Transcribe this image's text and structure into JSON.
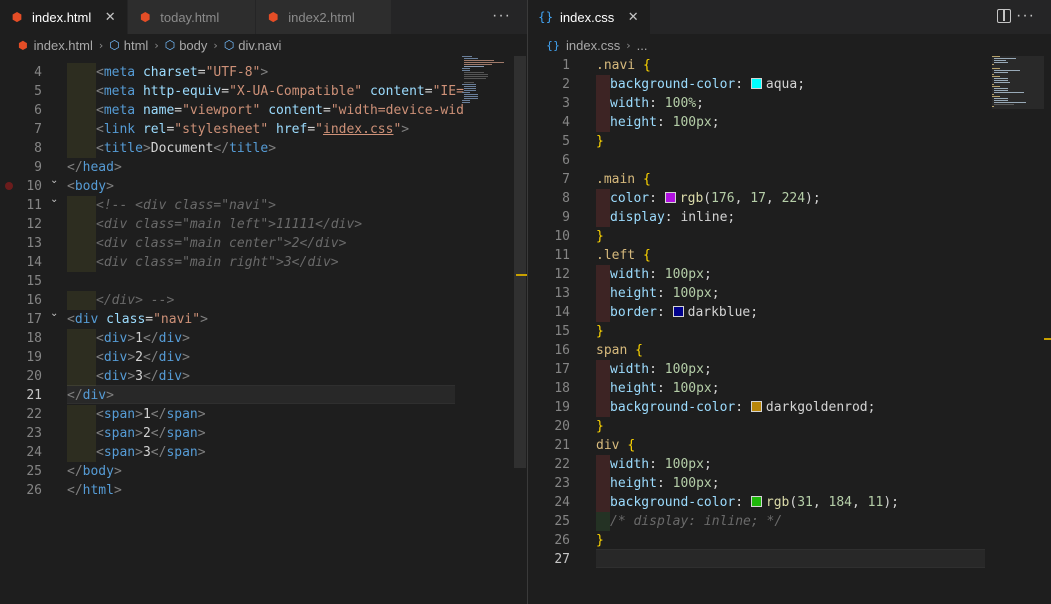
{
  "left_editor": {
    "tabs": [
      {
        "label": "index.html",
        "icon": "html5-icon",
        "active": true
      },
      {
        "label": "today.html",
        "icon": "html5-icon",
        "active": false
      },
      {
        "label": "index2.html",
        "icon": "html5-icon",
        "active": false
      }
    ],
    "more_actions": "···",
    "breadcrumb": [
      "index.html",
      "html",
      "body",
      "div.navi"
    ],
    "current_line": 21,
    "lines": [
      {
        "n": 4,
        "tokens": [
          [
            "g",
            ""
          ],
          [
            "tg",
            "<"
          ],
          [
            "tag",
            "meta "
          ],
          [
            "attr",
            "charset"
          ],
          [
            "pun",
            "="
          ],
          [
            "str",
            "\"UTF-8\""
          ],
          [
            "tg",
            ">"
          ]
        ]
      },
      {
        "n": 5,
        "tokens": [
          [
            "g",
            ""
          ],
          [
            "tg",
            "<"
          ],
          [
            "tag",
            "meta "
          ],
          [
            "attr",
            "http-equiv"
          ],
          [
            "pun",
            "="
          ],
          [
            "str",
            "\"X-UA-Compatible\""
          ],
          [
            "txt",
            " "
          ],
          [
            "attr",
            "content"
          ],
          [
            "pun",
            "="
          ],
          [
            "str",
            "\"IE="
          ]
        ]
      },
      {
        "n": 6,
        "tokens": [
          [
            "g",
            ""
          ],
          [
            "tg",
            "<"
          ],
          [
            "tag",
            "meta "
          ],
          [
            "attr",
            "name"
          ],
          [
            "pun",
            "="
          ],
          [
            "str",
            "\"viewport\""
          ],
          [
            "txt",
            " "
          ],
          [
            "attr",
            "content"
          ],
          [
            "pun",
            "="
          ],
          [
            "str",
            "\"width=device-wid"
          ]
        ]
      },
      {
        "n": 7,
        "tokens": [
          [
            "g",
            ""
          ],
          [
            "tg",
            "<"
          ],
          [
            "tag",
            "link "
          ],
          [
            "attr",
            "rel"
          ],
          [
            "pun",
            "="
          ],
          [
            "str",
            "\"stylesheet\""
          ],
          [
            "txt",
            " "
          ],
          [
            "attr",
            "href"
          ],
          [
            "pun",
            "="
          ],
          [
            "str",
            "\""
          ],
          [
            "stru",
            "index.css"
          ],
          [
            "str",
            "\""
          ],
          [
            "tg",
            ">"
          ]
        ]
      },
      {
        "n": 8,
        "tokens": [
          [
            "g",
            ""
          ],
          [
            "tg",
            "<"
          ],
          [
            "tag",
            "title"
          ],
          [
            "tg",
            ">"
          ],
          [
            "txt",
            "Document"
          ],
          [
            "tg",
            "</"
          ],
          [
            "tag",
            "title"
          ],
          [
            "tg",
            ">"
          ]
        ]
      },
      {
        "n": 9,
        "tokens": [
          [
            "tg",
            "</"
          ],
          [
            "tag",
            "head"
          ],
          [
            "tg",
            ">"
          ]
        ]
      },
      {
        "n": 10,
        "tokens": [
          [
            "tg",
            "<"
          ],
          [
            "tag",
            "body"
          ],
          [
            "tg",
            ">"
          ]
        ]
      },
      {
        "n": 11,
        "tokens": [
          [
            "g",
            ""
          ],
          [
            "cmt",
            "<!-- <div class=\"navi\">"
          ]
        ]
      },
      {
        "n": 12,
        "tokens": [
          [
            "g",
            ""
          ],
          [
            "cmt",
            "<div class=\"main left\">11111</div>"
          ]
        ]
      },
      {
        "n": 13,
        "tokens": [
          [
            "g",
            ""
          ],
          [
            "cmt",
            "<div class=\"main center\">2</div>"
          ]
        ]
      },
      {
        "n": 14,
        "tokens": [
          [
            "g",
            ""
          ],
          [
            "cmt",
            "<div class=\"main right\">3</div>"
          ]
        ]
      },
      {
        "n": 15,
        "tokens": []
      },
      {
        "n": 16,
        "tokens": [
          [
            "g",
            ""
          ],
          [
            "cmt",
            "</div> -->"
          ]
        ]
      },
      {
        "n": 17,
        "tokens": [
          [
            "tg",
            "<"
          ],
          [
            "tag",
            "div "
          ],
          [
            "attr",
            "class"
          ],
          [
            "pun",
            "="
          ],
          [
            "str",
            "\"navi\""
          ],
          [
            "tg",
            ">"
          ]
        ]
      },
      {
        "n": 18,
        "tokens": [
          [
            "g",
            ""
          ],
          [
            "tg",
            "<"
          ],
          [
            "tag",
            "div"
          ],
          [
            "tg",
            ">"
          ],
          [
            "txt",
            "1"
          ],
          [
            "tg",
            "</"
          ],
          [
            "tag",
            "div"
          ],
          [
            "tg",
            ">"
          ]
        ]
      },
      {
        "n": 19,
        "tokens": [
          [
            "g",
            ""
          ],
          [
            "tg",
            "<"
          ],
          [
            "tag",
            "div"
          ],
          [
            "tg",
            ">"
          ],
          [
            "txt",
            "2"
          ],
          [
            "tg",
            "</"
          ],
          [
            "tag",
            "div"
          ],
          [
            "tg",
            ">"
          ]
        ]
      },
      {
        "n": 20,
        "tokens": [
          [
            "g",
            ""
          ],
          [
            "tg",
            "<"
          ],
          [
            "tag",
            "div"
          ],
          [
            "tg",
            ">"
          ],
          [
            "txt",
            "3"
          ],
          [
            "tg",
            "</"
          ],
          [
            "tag",
            "div"
          ],
          [
            "tg",
            ">"
          ]
        ]
      },
      {
        "n": 21,
        "tokens": [
          [
            "tg",
            "</"
          ],
          [
            "tag",
            "div"
          ],
          [
            "tg",
            ">"
          ]
        ]
      },
      {
        "n": 22,
        "tokens": [
          [
            "g",
            ""
          ],
          [
            "tg",
            "<"
          ],
          [
            "tag",
            "span"
          ],
          [
            "tg",
            ">"
          ],
          [
            "txt",
            "1"
          ],
          [
            "tg",
            "</"
          ],
          [
            "tag",
            "span"
          ],
          [
            "tg",
            ">"
          ]
        ]
      },
      {
        "n": 23,
        "tokens": [
          [
            "g",
            ""
          ],
          [
            "tg",
            "<"
          ],
          [
            "tag",
            "span"
          ],
          [
            "tg",
            ">"
          ],
          [
            "txt",
            "2"
          ],
          [
            "tg",
            "</"
          ],
          [
            "tag",
            "span"
          ],
          [
            "tg",
            ">"
          ]
        ]
      },
      {
        "n": 24,
        "tokens": [
          [
            "g",
            ""
          ],
          [
            "tg",
            "<"
          ],
          [
            "tag",
            "span"
          ],
          [
            "tg",
            ">"
          ],
          [
            "txt",
            "3"
          ],
          [
            "tg",
            "</"
          ],
          [
            "tag",
            "span"
          ],
          [
            "tg",
            ">"
          ]
        ]
      },
      {
        "n": 25,
        "tokens": [
          [
            "tg",
            "</"
          ],
          [
            "tag",
            "body"
          ],
          [
            "tg",
            ">"
          ]
        ]
      },
      {
        "n": 26,
        "tokens": [
          [
            "tg",
            "</"
          ],
          [
            "tag",
            "html"
          ],
          [
            "tg",
            ">"
          ]
        ]
      }
    ]
  },
  "right_editor": {
    "tabs": [
      {
        "label": "index.css",
        "icon": "css-icon",
        "active": true
      }
    ],
    "more_actions": "···",
    "breadcrumb": [
      "index.css",
      "..."
    ],
    "current_line": 27,
    "lines": [
      {
        "n": 1,
        "tokens": [
          [
            "sel",
            ".navi "
          ],
          [
            "brace",
            "{"
          ]
        ]
      },
      {
        "n": 2,
        "tokens": [
          [
            "gr",
            ""
          ],
          [
            "prop",
            "background-color"
          ],
          [
            "pun",
            ": "
          ],
          [
            "sw",
            "#00ffff"
          ],
          [
            "val",
            "aqua"
          ],
          [
            "pun",
            ";"
          ]
        ]
      },
      {
        "n": 3,
        "tokens": [
          [
            "gr",
            ""
          ],
          [
            "prop",
            "width"
          ],
          [
            "pun",
            ": "
          ],
          [
            "num",
            "100%"
          ],
          [
            "pun",
            ";"
          ]
        ]
      },
      {
        "n": 4,
        "tokens": [
          [
            "gr",
            ""
          ],
          [
            "prop",
            "height"
          ],
          [
            "pun",
            ": "
          ],
          [
            "num",
            "100px"
          ],
          [
            "pun",
            ";"
          ]
        ]
      },
      {
        "n": 5,
        "tokens": [
          [
            "brace",
            "}"
          ]
        ]
      },
      {
        "n": 6,
        "tokens": []
      },
      {
        "n": 7,
        "tokens": [
          [
            "sel",
            ".main "
          ],
          [
            "brace",
            "{"
          ]
        ]
      },
      {
        "n": 8,
        "tokens": [
          [
            "gr",
            ""
          ],
          [
            "prop",
            "color"
          ],
          [
            "pun",
            ": "
          ],
          [
            "sw",
            "#b011e0"
          ],
          [
            "fn",
            "rgb"
          ],
          [
            "pun",
            "("
          ],
          [
            "num",
            "176"
          ],
          [
            "pun",
            ", "
          ],
          [
            "num",
            "17"
          ],
          [
            "pun",
            ", "
          ],
          [
            "num",
            "224"
          ],
          [
            "pun",
            ");"
          ]
        ]
      },
      {
        "n": 9,
        "tokens": [
          [
            "gr",
            ""
          ],
          [
            "prop",
            "display"
          ],
          [
            "pun",
            ": "
          ],
          [
            "val",
            "inline"
          ],
          [
            "pun",
            ";"
          ]
        ]
      },
      {
        "n": 10,
        "tokens": [
          [
            "brace",
            "}"
          ]
        ]
      },
      {
        "n": 11,
        "tokens": [
          [
            "sel",
            ".left "
          ],
          [
            "brace",
            "{"
          ]
        ]
      },
      {
        "n": 12,
        "tokens": [
          [
            "gr",
            ""
          ],
          [
            "prop",
            "width"
          ],
          [
            "pun",
            ": "
          ],
          [
            "num",
            "100px"
          ],
          [
            "pun",
            ";"
          ]
        ]
      },
      {
        "n": 13,
        "tokens": [
          [
            "gr",
            ""
          ],
          [
            "prop",
            "height"
          ],
          [
            "pun",
            ": "
          ],
          [
            "num",
            "100px"
          ],
          [
            "pun",
            ";"
          ]
        ]
      },
      {
        "n": 14,
        "tokens": [
          [
            "gr",
            ""
          ],
          [
            "prop",
            "border"
          ],
          [
            "pun",
            ": "
          ],
          [
            "sw",
            "#00008b"
          ],
          [
            "val",
            "darkblue"
          ],
          [
            "pun",
            ";"
          ]
        ]
      },
      {
        "n": 15,
        "tokens": [
          [
            "brace",
            "}"
          ]
        ]
      },
      {
        "n": 16,
        "tokens": [
          [
            "sel",
            "span "
          ],
          [
            "brace",
            "{"
          ]
        ]
      },
      {
        "n": 17,
        "tokens": [
          [
            "gr",
            ""
          ],
          [
            "prop",
            "width"
          ],
          [
            "pun",
            ": "
          ],
          [
            "num",
            "100px"
          ],
          [
            "pun",
            ";"
          ]
        ]
      },
      {
        "n": 18,
        "tokens": [
          [
            "gr",
            ""
          ],
          [
            "prop",
            "height"
          ],
          [
            "pun",
            ": "
          ],
          [
            "num",
            "100px"
          ],
          [
            "pun",
            ";"
          ]
        ]
      },
      {
        "n": 19,
        "tokens": [
          [
            "gr",
            ""
          ],
          [
            "prop",
            "background-color"
          ],
          [
            "pun",
            ": "
          ],
          [
            "sw",
            "#b8860b"
          ],
          [
            "val",
            "darkgoldenrod"
          ],
          [
            "pun",
            ";"
          ]
        ]
      },
      {
        "n": 20,
        "tokens": [
          [
            "brace",
            "}"
          ]
        ]
      },
      {
        "n": 21,
        "tokens": [
          [
            "sel",
            "div "
          ],
          [
            "brace",
            "{"
          ]
        ]
      },
      {
        "n": 22,
        "tokens": [
          [
            "gr",
            ""
          ],
          [
            "prop",
            "width"
          ],
          [
            "pun",
            ": "
          ],
          [
            "num",
            "100px"
          ],
          [
            "pun",
            ";"
          ]
        ]
      },
      {
        "n": 23,
        "tokens": [
          [
            "gr",
            ""
          ],
          [
            "prop",
            "height"
          ],
          [
            "pun",
            ": "
          ],
          [
            "num",
            "100px"
          ],
          [
            "pun",
            ";"
          ]
        ]
      },
      {
        "n": 24,
        "tokens": [
          [
            "gr",
            ""
          ],
          [
            "prop",
            "background-color"
          ],
          [
            "pun",
            ": "
          ],
          [
            "sw",
            "#1fb80b"
          ],
          [
            "fn",
            "rgb"
          ],
          [
            "pun",
            "("
          ],
          [
            "num",
            "31"
          ],
          [
            "pun",
            ", "
          ],
          [
            "num",
            "184"
          ],
          [
            "pun",
            ", "
          ],
          [
            "num",
            "11"
          ],
          [
            "pun",
            ");"
          ]
        ]
      },
      {
        "n": 25,
        "tokens": [
          [
            "gg",
            ""
          ],
          [
            "cmt",
            "/* display: inline; */"
          ]
        ]
      },
      {
        "n": 26,
        "tokens": [
          [
            "brace",
            "}"
          ]
        ]
      },
      {
        "n": 27,
        "tokens": []
      }
    ]
  },
  "colors": {
    "editor_bg": "#1e1e1e",
    "tabbar_bg": "#252526",
    "html_icon": "#e44d26",
    "css_icon": "#42a5f5"
  }
}
